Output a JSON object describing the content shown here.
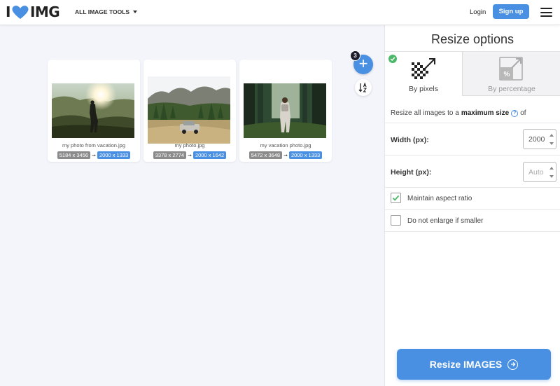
{
  "header": {
    "logo_left": "I",
    "logo_right": "IMG",
    "tools_label": "ALL IMAGE TOOLS",
    "login_label": "Login",
    "signup_label": "Sign up"
  },
  "workspace": {
    "file_count": "3",
    "add_label": "+",
    "files": [
      {
        "name": "my photo from vacation.jpg",
        "original_size": "5184 x 3456",
        "new_size": "2000 x 1333"
      },
      {
        "name": "my photo.jpg",
        "original_size": "3378 x 2774",
        "new_size": "2000 x 1642"
      },
      {
        "name": "my vacation photo.jpg",
        "original_size": "5472 x 3648",
        "new_size": "2000 x 1333"
      }
    ]
  },
  "sidebar": {
    "title": "Resize options",
    "tabs": [
      {
        "label": "By pixels",
        "selected": true
      },
      {
        "label": "By percentage",
        "selected": false
      }
    ],
    "description_prefix": "Resize all images to a",
    "description_bold": "maximum size",
    "description_suffix": "of",
    "help_glyph": "?",
    "width_label": "Width (px):",
    "width_value": "2000",
    "height_label": "Height (px):",
    "height_placeholder": "Auto",
    "maintain_aspect_label": "Maintain aspect ratio",
    "maintain_aspect_checked": true,
    "no_enlarge_label": "Do not enlarge if smaller",
    "no_enlarge_checked": false,
    "submit_label": "Resize IMAGES"
  },
  "colors": {
    "accent": "#4a90e2",
    "check_green": "#4cb96a",
    "original_badge": "#8b8b8b",
    "logo_heart": "#4a90e2"
  }
}
